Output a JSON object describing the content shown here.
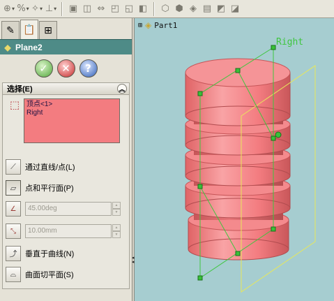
{
  "toolbar": {
    "buttons": [
      {
        "name": "view-orientation-icon"
      },
      {
        "name": "percent-zoom-icon",
        "label": "%"
      },
      {
        "name": "rotate-view-icon"
      },
      {
        "name": "axis-display-icon"
      },
      {
        "name": "view-front-icon"
      },
      {
        "name": "view-back-icon"
      },
      {
        "name": "view-left-icon"
      },
      {
        "name": "view-right-icon"
      },
      {
        "name": "view-top-icon"
      },
      {
        "name": "shaded-icon"
      },
      {
        "name": "hidden-lines-icon"
      },
      {
        "name": "wireframe-icon"
      },
      {
        "name": "perspective-icon"
      },
      {
        "name": "section-view-icon"
      },
      {
        "name": "edges-icon"
      }
    ]
  },
  "panel": {
    "title": "Plane2",
    "section_title": "选择(E)",
    "selections": [
      "顶点<1>",
      "Right"
    ],
    "options": [
      {
        "label": "通过直线/点(L)"
      },
      {
        "label": "点和平行面(P)"
      }
    ],
    "angle": {
      "value": "45.00deg"
    },
    "offset": {
      "value": "10.00mm"
    },
    "options2": [
      {
        "label": "垂直于曲线(N)"
      },
      {
        "label": "曲面切平面(S)"
      }
    ]
  },
  "viewport": {
    "tree_root": "Part1",
    "plane_label": "Right",
    "model_color": "#f37c80",
    "plane_color": "#e8e85a",
    "preview_color": "#3fc63f"
  }
}
